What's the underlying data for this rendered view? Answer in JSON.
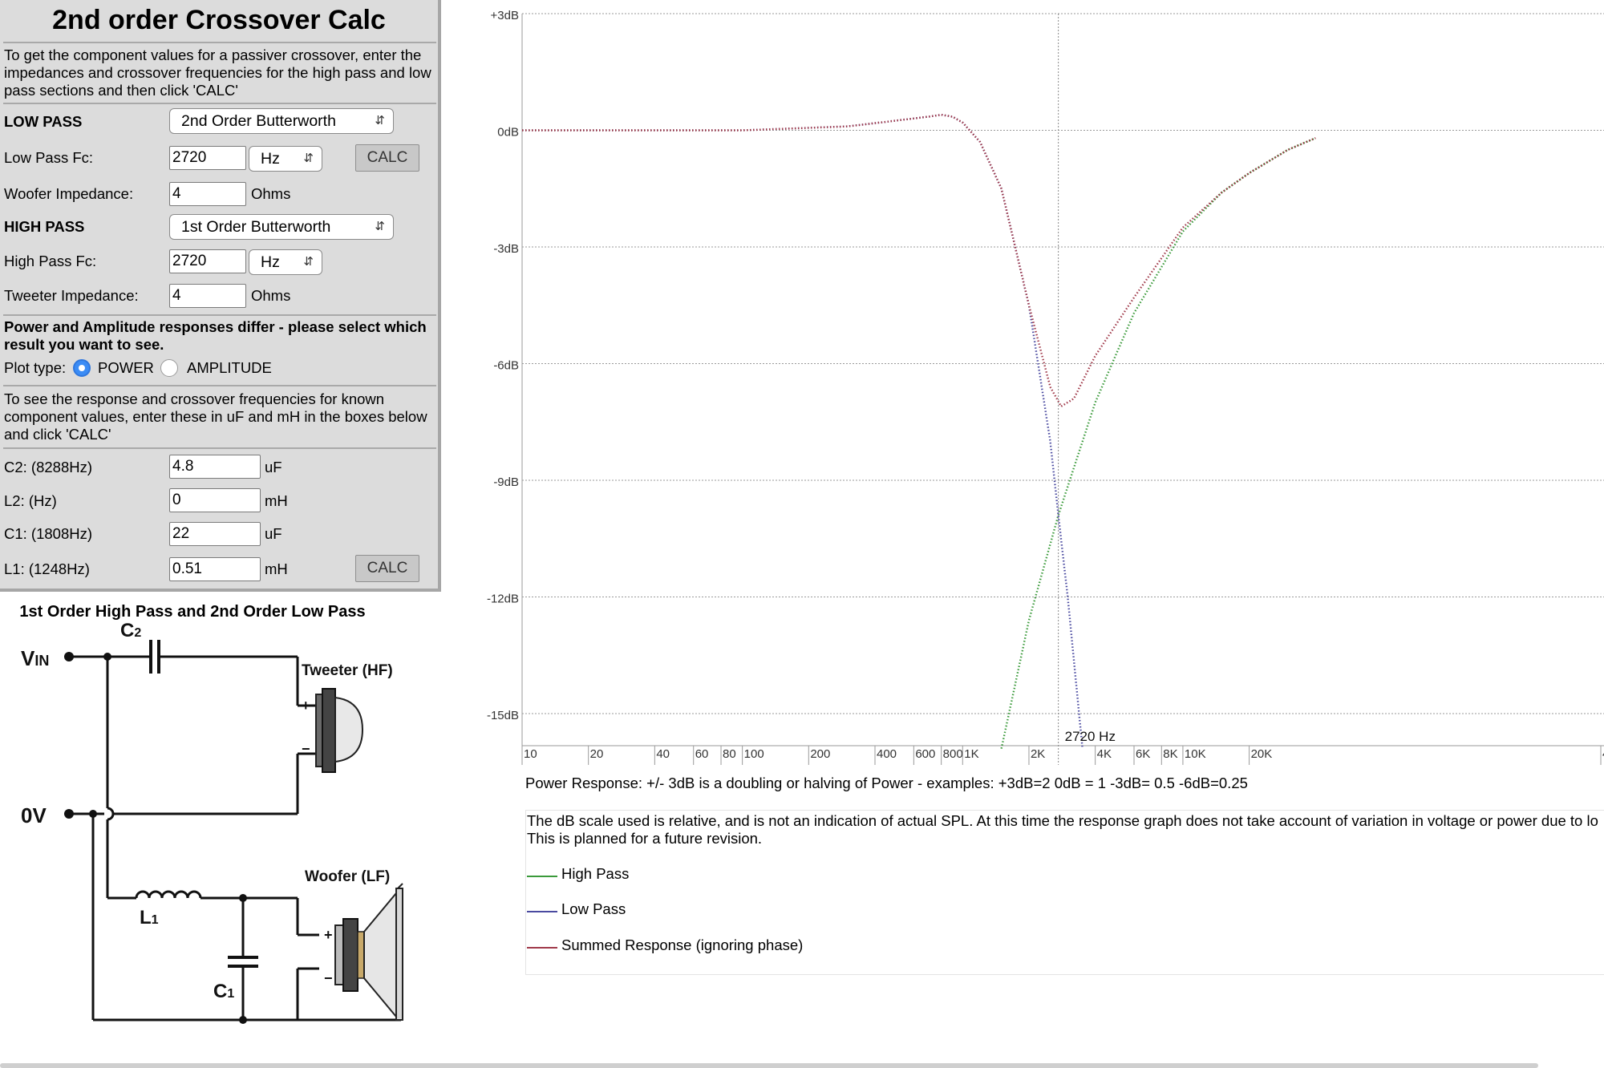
{
  "panel": {
    "title": "2nd order Crossover Calc",
    "intro": "To get the component values for a passiver crossover, enter the impedances and crossover frequencies for the high pass and low pass sections and then click 'CALC'",
    "low_pass_heading": "LOW PASS",
    "low_pass_filter": "2nd Order Butterworth",
    "low_pass_fc_label": "Low Pass Fc:",
    "low_pass_fc_value": "2720",
    "low_pass_fc_unit": "Hz",
    "calc_label": "CALC",
    "woofer_impedance_label": "Woofer Impedance:",
    "woofer_impedance_value": "4",
    "ohms": "Ohms",
    "high_pass_heading": "HIGH PASS",
    "high_pass_filter": "1st Order Butterworth",
    "high_pass_fc_label": "High Pass Fc:",
    "high_pass_fc_value": "2720",
    "high_pass_fc_unit": "Hz",
    "tweeter_impedance_label": "Tweeter Impedance:",
    "tweeter_impedance_value": "4",
    "response_note": "Power and Amplitude responses differ - please select which result you want to see.",
    "plot_type_label": "Plot type:",
    "plot_power": "POWER",
    "plot_amplitude": "AMPLITUDE",
    "plot_selected": "POWER",
    "known_values_note": "To see the response and crossover frequencies for known component values, enter these in uF and mH in the boxes below and click 'CALC'",
    "components": [
      {
        "label": "C2: (8288Hz)",
        "value": "4.8",
        "unit": "uF"
      },
      {
        "label": "L2: (Hz)",
        "value": "0",
        "unit": "mH"
      },
      {
        "label": "C1: (1808Hz)",
        "value": "22",
        "unit": "uF"
      },
      {
        "label": "L1: (1248Hz)",
        "value": "0.51",
        "unit": "mH"
      }
    ]
  },
  "schematic": {
    "title": "1st Order High Pass and 2nd Order Low Pass",
    "vin": "V",
    "vin_sub": "IN",
    "zero_v": "0V",
    "c2": "C",
    "c2_sub": "2",
    "c1": "C",
    "c1_sub": "1",
    "l1": "L",
    "l1_sub": "1",
    "tweeter": "Tweeter (HF)",
    "woofer": "Woofer (LF)",
    "plus": "+",
    "minus": "−"
  },
  "chart_data": {
    "type": "line",
    "x_scale": "log",
    "xlim": [
      10,
      40000
    ],
    "ylim": [
      -16.2,
      3
    ],
    "y_ticks": [
      {
        "v": 3,
        "label": "+3dB"
      },
      {
        "v": 0,
        "label": "0dB"
      },
      {
        "v": -3,
        "label": "-3dB"
      },
      {
        "v": -6,
        "label": "-6dB"
      },
      {
        "v": -9,
        "label": "-9dB"
      },
      {
        "v": -12,
        "label": "-12dB"
      },
      {
        "v": -15,
        "label": "-15dB"
      }
    ],
    "x_ticks": [
      {
        "v": 10,
        "label": "10"
      },
      {
        "v": 20,
        "label": "20"
      },
      {
        "v": 40,
        "label": "40"
      },
      {
        "v": 60,
        "label": "60"
      },
      {
        "v": 80,
        "label": "80"
      },
      {
        "v": 100,
        "label": "100"
      },
      {
        "v": 200,
        "label": "200"
      },
      {
        "v": 400,
        "label": "400"
      },
      {
        "v": 600,
        "label": "600"
      },
      {
        "v": 800,
        "label": "800"
      },
      {
        "v": 1000,
        "label": "1K"
      },
      {
        "v": 2000,
        "label": "2K"
      },
      {
        "v": 4000,
        "label": "4K"
      },
      {
        "v": 6000,
        "label": "6K"
      },
      {
        "v": 8000,
        "label": "8K"
      },
      {
        "v": 10000,
        "label": "10K"
      },
      {
        "v": 20000,
        "label": "20K"
      },
      {
        "v": 40000,
        "label": "4"
      }
    ],
    "crossover_marker": {
      "x": 2720,
      "label": "2720 Hz"
    },
    "grid": true,
    "series": [
      {
        "name": "High Pass",
        "color": "#3a9a3a",
        "style": "dotted",
        "x": [
          1500,
          2000,
          2720,
          4000,
          6000,
          10000,
          15000,
          20000,
          30000,
          40000
        ],
        "y": [
          -15.9,
          -12.6,
          -9.9,
          -7.0,
          -4.7,
          -2.6,
          -1.6,
          -1.1,
          -0.5,
          -0.2
        ]
      },
      {
        "name": "Low Pass",
        "color": "#4a4aa0",
        "style": "dotted",
        "x": [
          10,
          100,
          300,
          500,
          700,
          800,
          900,
          1000,
          1200,
          1500,
          2000,
          2500,
          2720,
          3000,
          3500
        ],
        "y": [
          0,
          0,
          0.1,
          0.25,
          0.35,
          0.4,
          0.35,
          0.2,
          -0.3,
          -1.5,
          -4.5,
          -8.0,
          -9.9,
          -12.0,
          -15.9
        ]
      },
      {
        "name": "Summed Response (ignoring phase)",
        "color": "#a03a4a",
        "style": "dotted",
        "x": [
          10,
          100,
          300,
          500,
          700,
          800,
          900,
          1000,
          1200,
          1500,
          2000,
          2500,
          2800,
          3200,
          4000,
          6000,
          10000,
          15000,
          20000,
          30000,
          40000
        ],
        "y": [
          0,
          0,
          0.1,
          0.25,
          0.35,
          0.4,
          0.35,
          0.2,
          -0.3,
          -1.5,
          -4.5,
          -6.6,
          -7.1,
          -6.9,
          -5.8,
          -4.3,
          -2.5,
          -1.6,
          -1.1,
          -0.5,
          -0.2
        ]
      }
    ]
  },
  "notes": {
    "power_response": "Power Response: +/- 3dB is a doubling or halving of Power - examples: +3dB=2  0dB = 1  -3dB= 0.5  -6dB=0.25",
    "db_scale_1": "The dB scale used is relative, and is not an indication of actual SPL. At this time the response graph does not take account of variation in voltage or power due to lo",
    "db_scale_2": "This is planned for a future revision."
  },
  "legend": [
    {
      "label": "High Pass",
      "color": "#3a9a3a"
    },
    {
      "label": "Low Pass",
      "color": "#4a4aa0"
    },
    {
      "label": "Summed Response (ignoring phase)",
      "color": "#a03a4a"
    }
  ]
}
